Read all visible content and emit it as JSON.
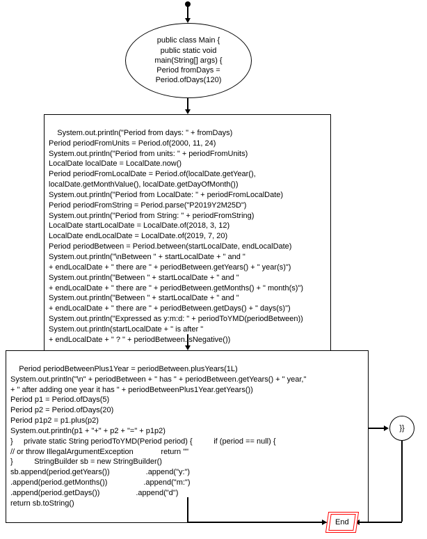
{
  "flowchart": {
    "startNode": "public class Main {\n  public static void\nmain(String[] args) {\n  Period fromDays =\nPeriod.ofDays(120)",
    "block1": "System.out.println(\"Period from days: \" + fromDays)\nPeriod periodFromUnits = Period.of(2000, 11, 24)\nSystem.out.println(\"Period from units: \" + periodFromUnits)\nLocalDate localDate = LocalDate.now()\nPeriod periodFromLocalDate = Period.of(localDate.getYear(),\nlocalDate.getMonthValue(), localDate.getDayOfMonth())\nSystem.out.println(\"Period from LocalDate: \" + periodFromLocalDate)\nPeriod periodFromString = Period.parse(\"P2019Y2M25D\")\nSystem.out.println(\"Period from String: \" + periodFromString)\nLocalDate startLocalDate = LocalDate.of(2018, 3, 12)\nLocalDate endLocalDate = LocalDate.of(2019, 7, 20)\nPeriod periodBetween = Period.between(startLocalDate, endLocalDate)\nSystem.out.println(\"\\nBetween \" + startLocalDate + \" and \"\n+ endLocalDate + \" there are \" + periodBetween.getYears() + \" year(s)\")\nSystem.out.println(\"Between \" + startLocalDate + \" and \"\n+ endLocalDate + \" there are \" + periodBetween.getMonths() + \" month(s)\")\nSystem.out.println(\"Between \" + startLocalDate + \" and \"\n+ endLocalDate + \" there are \" + periodBetween.getDays() + \" days(s)\")\nSystem.out.println(\"Expressed as y:m:d: \" + periodToYMD(periodBetween))\nSystem.out.println(startLocalDate + \" is after \"\n+ endLocalDate + \" ? \" + periodBetween.isNegative())",
    "block2": "Period periodBetweenPlus1Year = periodBetween.plusYears(1L)\nSystem.out.println(\"\\n\" + periodBetween + \" has \" + periodBetween.getYears() + \" year,\"\n+ \" after adding one year it has \" + periodBetweenPlus1Year.getYears())\nPeriod p1 = Period.ofDays(5)\nPeriod p2 = Period.ofDays(20)\nPeriod p1p2 = p1.plus(p2)\nSystem.out.println(p1 + \"+\" + p2 + \"=\" + p1p2)\n}     private static String periodToYMD(Period period) {          if (period == null) {\n// or throw IllegalArgumentException             return \"\"\n}          StringBuilder sb = new StringBuilder()\nsb.append(period.getYears())                 .append(\"y:\")\n.append(period.getMonths())                 .append(\"m:\")\n.append(period.getDays())                 .append(\"d\")\nreturn sb.toString()",
    "sideNode": "}}",
    "endNode": "End"
  }
}
